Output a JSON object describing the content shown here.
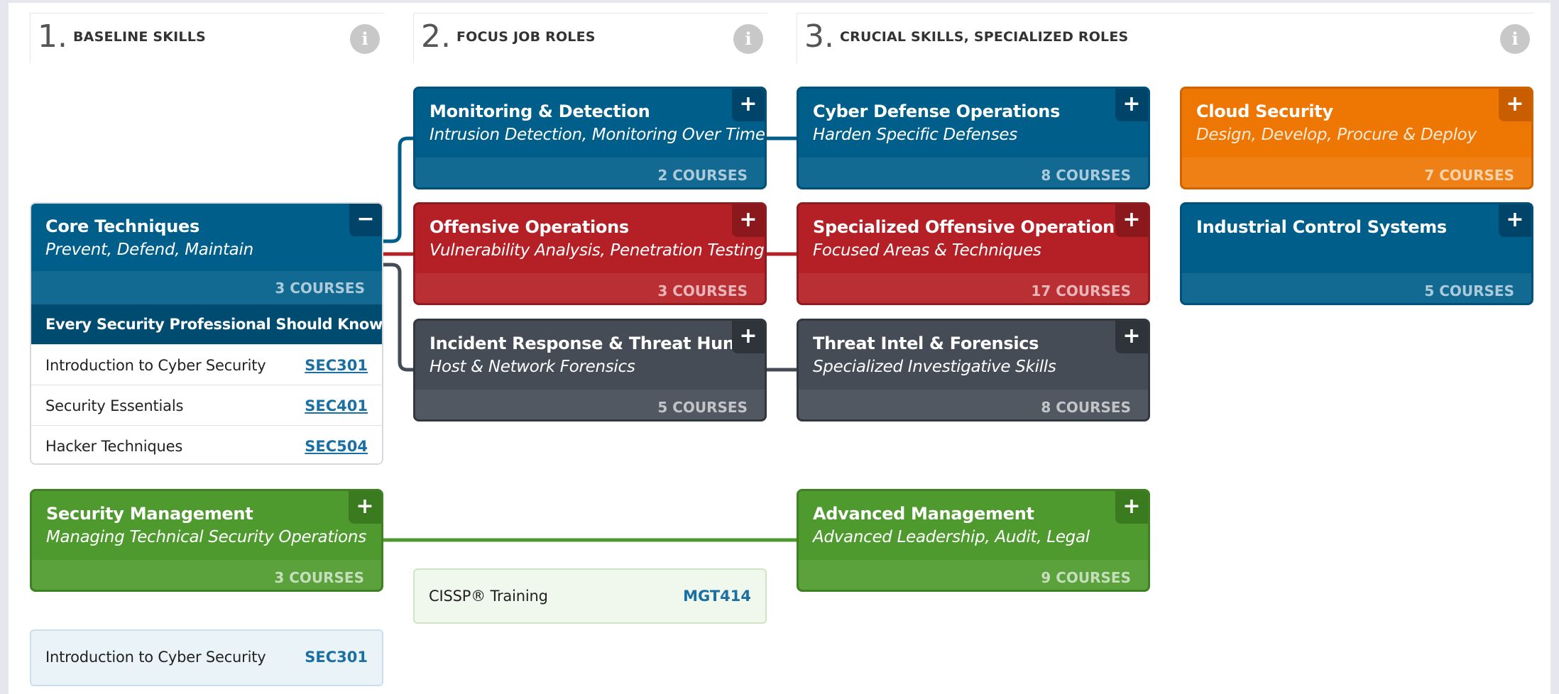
{
  "columns": [
    {
      "num": "1.",
      "title": "BASELINE SKILLS"
    },
    {
      "num": "2.",
      "title": "FOCUS JOB ROLES"
    },
    {
      "num": "3.",
      "title": "CRUCIAL SKILLS, SPECIALIZED ROLES"
    }
  ],
  "info_icon": "i",
  "core": {
    "title": "Core Techniques",
    "subtitle": "Prevent, Defend, Maintain",
    "count": "3 COURSES",
    "toggle": "−",
    "section_header": "Every Security Professional Should Know",
    "courses": [
      {
        "name": "Introduction to Cyber Security",
        "code": "SEC301"
      },
      {
        "name": "Security Essentials",
        "code": "SEC401"
      },
      {
        "name": "Hacker Techniques",
        "code": "SEC504"
      }
    ]
  },
  "cards": {
    "monitoring": {
      "title": "Monitoring & Detection",
      "subtitle": "Intrusion Detection, Monitoring Over Time",
      "count": "2 COURSES",
      "toggle": "+"
    },
    "offensive": {
      "title": "Offensive Operations",
      "subtitle": "Vulnerability Analysis, Penetration Testing",
      "count": "3 COURSES",
      "toggle": "+"
    },
    "incident": {
      "title": "Incident Response & Threat Hunting",
      "subtitle": "Host & Network Forensics",
      "count": "5 COURSES",
      "toggle": "+"
    },
    "cyber_defense": {
      "title": "Cyber Defense Operations",
      "subtitle": "Harden Specific Defenses",
      "count": "8 COURSES",
      "toggle": "+"
    },
    "spec_offensive": {
      "title": "Specialized Offensive Operations",
      "subtitle": "Focused Areas & Techniques",
      "count": "17 COURSES",
      "toggle": "+"
    },
    "threat_intel": {
      "title": "Threat Intel & Forensics",
      "subtitle": "Specialized Investigative Skills",
      "count": "8 COURSES",
      "toggle": "+"
    },
    "cloud": {
      "title": "Cloud Security",
      "subtitle": "Design, Develop, Procure & Deploy",
      "count": "7 COURSES",
      "toggle": "+"
    },
    "ics": {
      "title": "Industrial Control Systems",
      "subtitle": "",
      "count": "5 COURSES",
      "toggle": "+"
    },
    "sec_mgmt": {
      "title": "Security Management",
      "subtitle": "Managing Technical Security Operations",
      "count": "3 COURSES",
      "toggle": "+"
    },
    "adv_mgmt": {
      "title": "Advanced Management",
      "subtitle": "Advanced Leadership, Audit, Legal",
      "count": "9 COURSES",
      "toggle": "+"
    }
  },
  "extra_courses": {
    "cissp": {
      "name": "CISSP® Training",
      "code": "MGT414"
    },
    "intro": {
      "name": "Introduction to Cyber Security",
      "code": "SEC301"
    }
  },
  "colors": {
    "blue": "#005e8a",
    "red": "#b42025",
    "dark": "#454c55",
    "green": "#4f9a2e",
    "orange": "#ee7704",
    "link": "#1a6fa3"
  }
}
